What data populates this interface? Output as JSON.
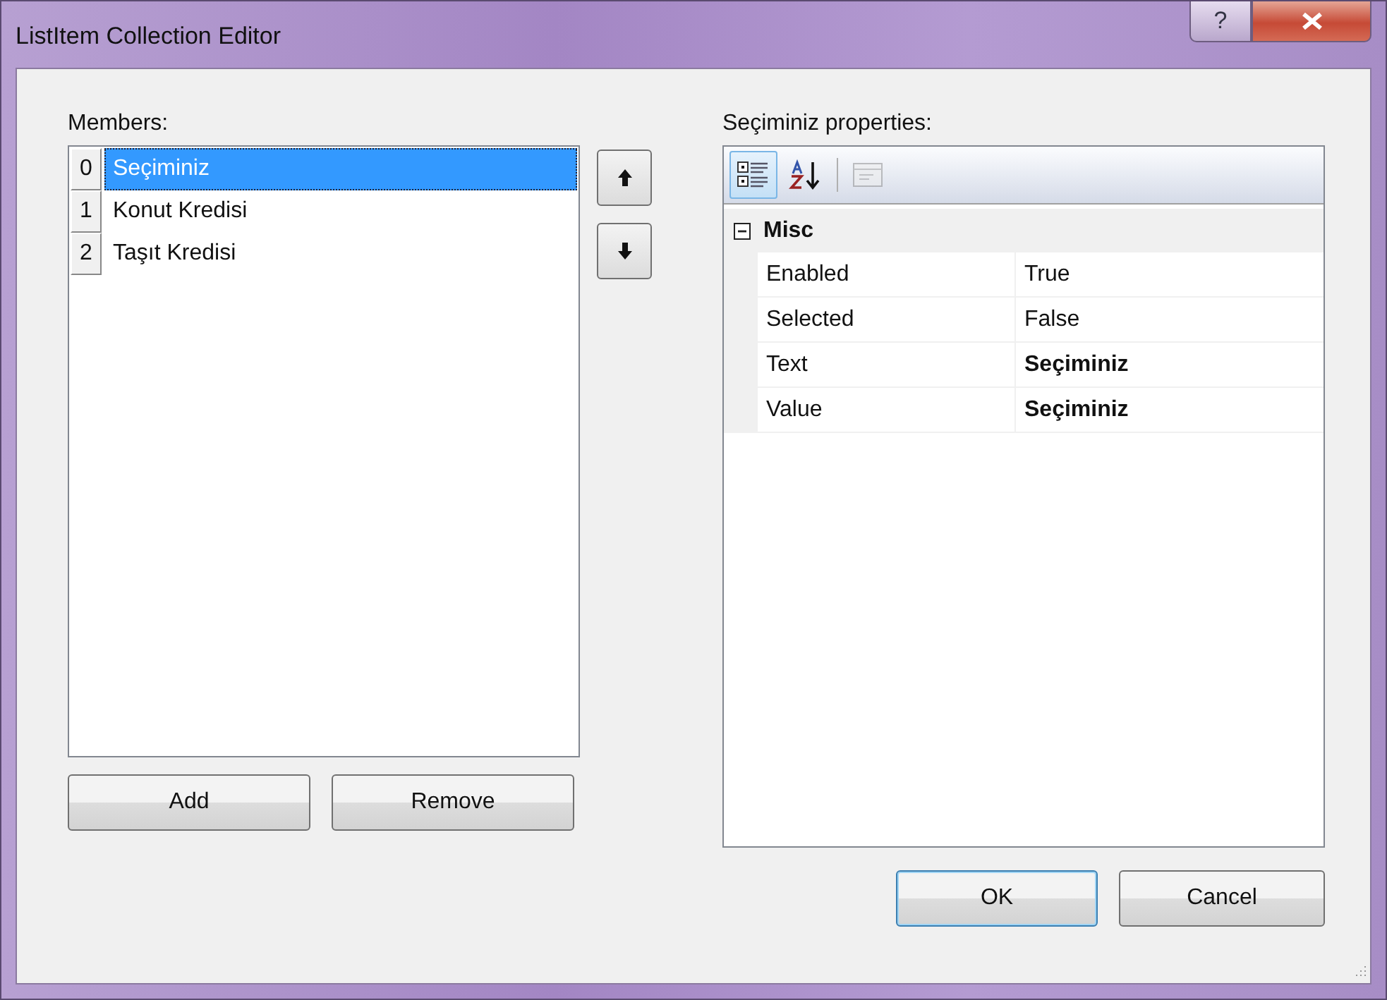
{
  "window": {
    "title": "ListItem Collection Editor",
    "help_button": "?"
  },
  "members": {
    "label": "Members:",
    "items": [
      {
        "index": "0",
        "text": "Seçiminiz",
        "selected": true
      },
      {
        "index": "1",
        "text": "Konut Kredisi",
        "selected": false
      },
      {
        "index": "2",
        "text": "Taşıt Kredisi",
        "selected": false
      }
    ]
  },
  "properties": {
    "label": "Seçiminiz properties:",
    "toolbar": [
      {
        "kind": "categorized",
        "selected": true,
        "disabled": false
      },
      {
        "kind": "alphabetical",
        "selected": false,
        "disabled": false
      },
      {
        "kind": "pages",
        "selected": false,
        "disabled": true
      }
    ],
    "categories": [
      {
        "name": "Misc",
        "expanded": true,
        "rows": [
          {
            "name": "Enabled",
            "value": "True",
            "modified": false
          },
          {
            "name": "Selected",
            "value": "False",
            "modified": false
          },
          {
            "name": "Text",
            "value": "Seçiminiz",
            "modified": true
          },
          {
            "name": "Value",
            "value": "Seçiminiz",
            "modified": true
          }
        ]
      }
    ]
  },
  "buttons": {
    "add": "Add",
    "remove": "Remove",
    "ok": "OK",
    "cancel": "Cancel"
  }
}
